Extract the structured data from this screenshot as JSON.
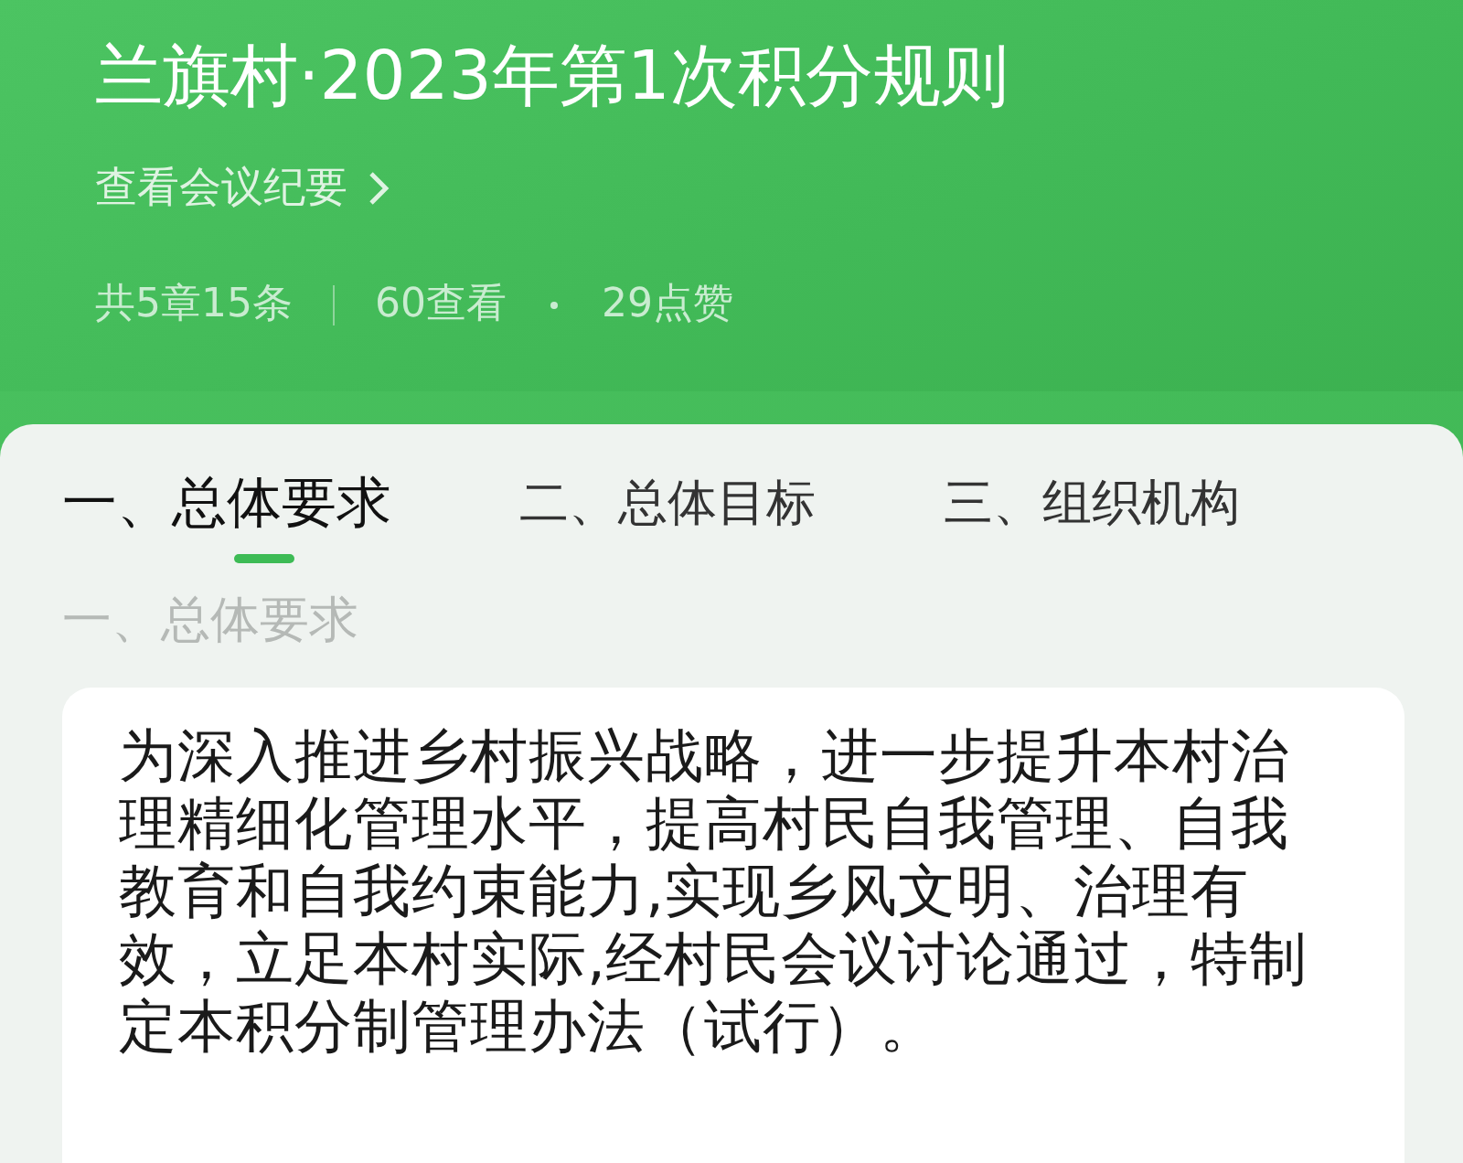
{
  "header": {
    "title": "兰旗村·2023年第1次积分规则",
    "minutes_link": "查看会议纪要",
    "stats": [
      "共5章15条",
      "60查看",
      "29点赞"
    ]
  },
  "tabs": [
    {
      "label": "一、总体要求",
      "selected": true
    },
    {
      "label": "二、总体目标",
      "selected": false
    },
    {
      "label": "三、组织机构",
      "selected": false
    }
  ],
  "section": {
    "title": "一、总体要求",
    "paragraph": "为深入推进乡村振兴战略，进一步提升本村治理精细化管理水平，提高村民自我管理、自我教育和自我约束能力,实现乡风文明、治理有效，立足本村实际,经村民会议讨论通过，特制定本积分制管理办法（试行）。"
  }
}
